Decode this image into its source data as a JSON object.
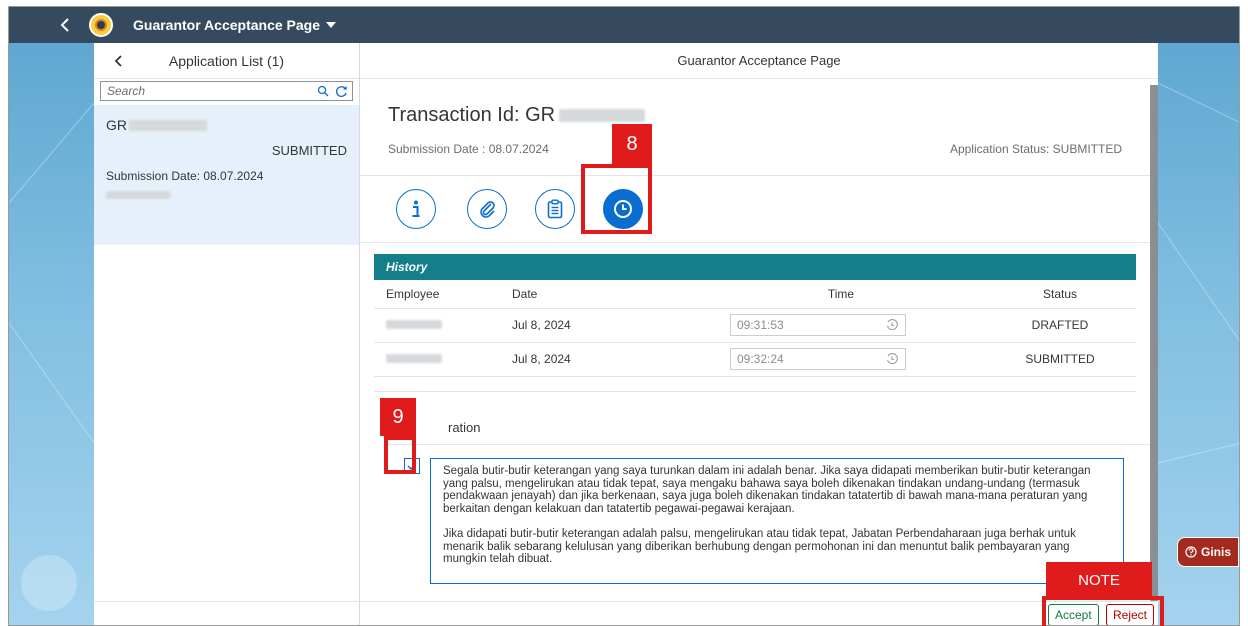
{
  "shell": {
    "title": "Guarantor Acceptance Page"
  },
  "master": {
    "title": "Application List (1)",
    "search_placeholder": "Search",
    "item": {
      "id_prefix": "GR",
      "status": "SUBMITTED",
      "submission": "Submission Date: 08.07.2024"
    }
  },
  "detail": {
    "title": "Guarantor Acceptance Page",
    "transaction_label": "Transaction Id: GR",
    "submission": "Submission Date : 08.07.2024",
    "app_status": "Application Status: SUBMITTED",
    "tabs": [
      "info-icon",
      "attachment-icon",
      "clipboard-icon",
      "clock-icon"
    ]
  },
  "history": {
    "title": "History",
    "columns": [
      "Employee",
      "Date",
      "Time",
      "Status"
    ],
    "rows": [
      {
        "date": "Jul 8, 2024",
        "time": "09:31:53",
        "status": "DRAFTED"
      },
      {
        "date": "Jul 8, 2024",
        "time": "09:32:24",
        "status": "SUBMITTED"
      }
    ]
  },
  "declaration": {
    "title_fragment": "ration",
    "checked": true,
    "para1": "Segala butir-butir keterangan yang saya turunkan dalam ini adalah benar. Jika saya didapati memberikan butir-butir keterangan yang palsu, mengelirukan atau tidak tepat, saya mengaku bahawa saya boleh dikenakan tindakan undang-undang (termasuk pendakwaan jenayah) dan jika berkenaan, saya juga boleh dikenakan tindakan tatatertib di bawah mana-mana peraturan yang berkaitan dengan kelakuan dan tatatertib pegawai-pegawai kerajaan.",
    "para2": "Jika didapati butir-butir keterangan adalah palsu, mengelirukan atau tidak tepat, Jabatan Perbendaharaan juga berhak untuk menarik balik sebarang kelulusan yang diberikan berhubung dengan permohonan ini dan menuntut balik pembayaran yang mungkin telah dibuat."
  },
  "actions": {
    "accept": "Accept",
    "reject": "Reject"
  },
  "annotations": {
    "step8": "8",
    "step9": "9",
    "note": "NOTE"
  },
  "ginis": {
    "label": "Ginis"
  },
  "colors": {
    "shell": "#354a5f",
    "accent": "#0a6ed1",
    "history_bar": "#147f8a",
    "annotation": "#e01b1b"
  }
}
